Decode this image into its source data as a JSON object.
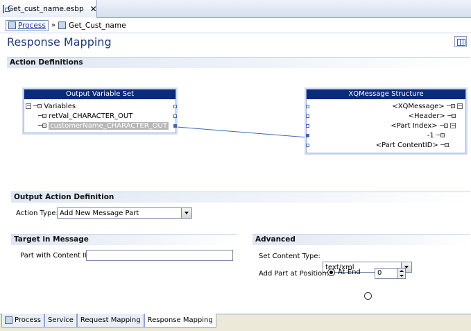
{
  "editor_tab": {
    "label": "Get_cust_name.esbp",
    "close": "✕"
  },
  "breadcrumb": {
    "process": "Process",
    "separator": "»",
    "current": "Get_Cust_name"
  },
  "page_title": "Response Mapping",
  "action_definitions": {
    "heading": "Action Definitions",
    "output_box": {
      "title": "Output Variable Set",
      "root": "Variables",
      "items": [
        "retVal_CHARACTER_OUT",
        "customerName_CHARACTER_OUT"
      ]
    },
    "xq_box": {
      "title": "XQMessage Structure",
      "items": [
        "<XQMessage>",
        "<Header>",
        "<Part Index>",
        "-1",
        "<Part ContentID>"
      ]
    }
  },
  "output_action": {
    "heading": "Output Action Definition",
    "action_type_label": "Action Type:",
    "action_type_value": "Add New Message Part"
  },
  "target": {
    "heading": "Target in Message",
    "content_id_label": "Part with Content ID:",
    "content_id_value": ""
  },
  "advanced": {
    "heading": "Advanced",
    "content_type_label": "Set Content Type:",
    "content_type_value": "text/xml",
    "position_label": "Add Part at Position:",
    "at_end_label": "At End",
    "position_value": "0"
  },
  "bottom_tabs": [
    "Process",
    "Service",
    "Request Mapping",
    "Response Mapping"
  ],
  "colors": {
    "header_blue": "#0a2a7a",
    "title_blue": "#1f3a73",
    "link_line": "#3c66b3"
  }
}
